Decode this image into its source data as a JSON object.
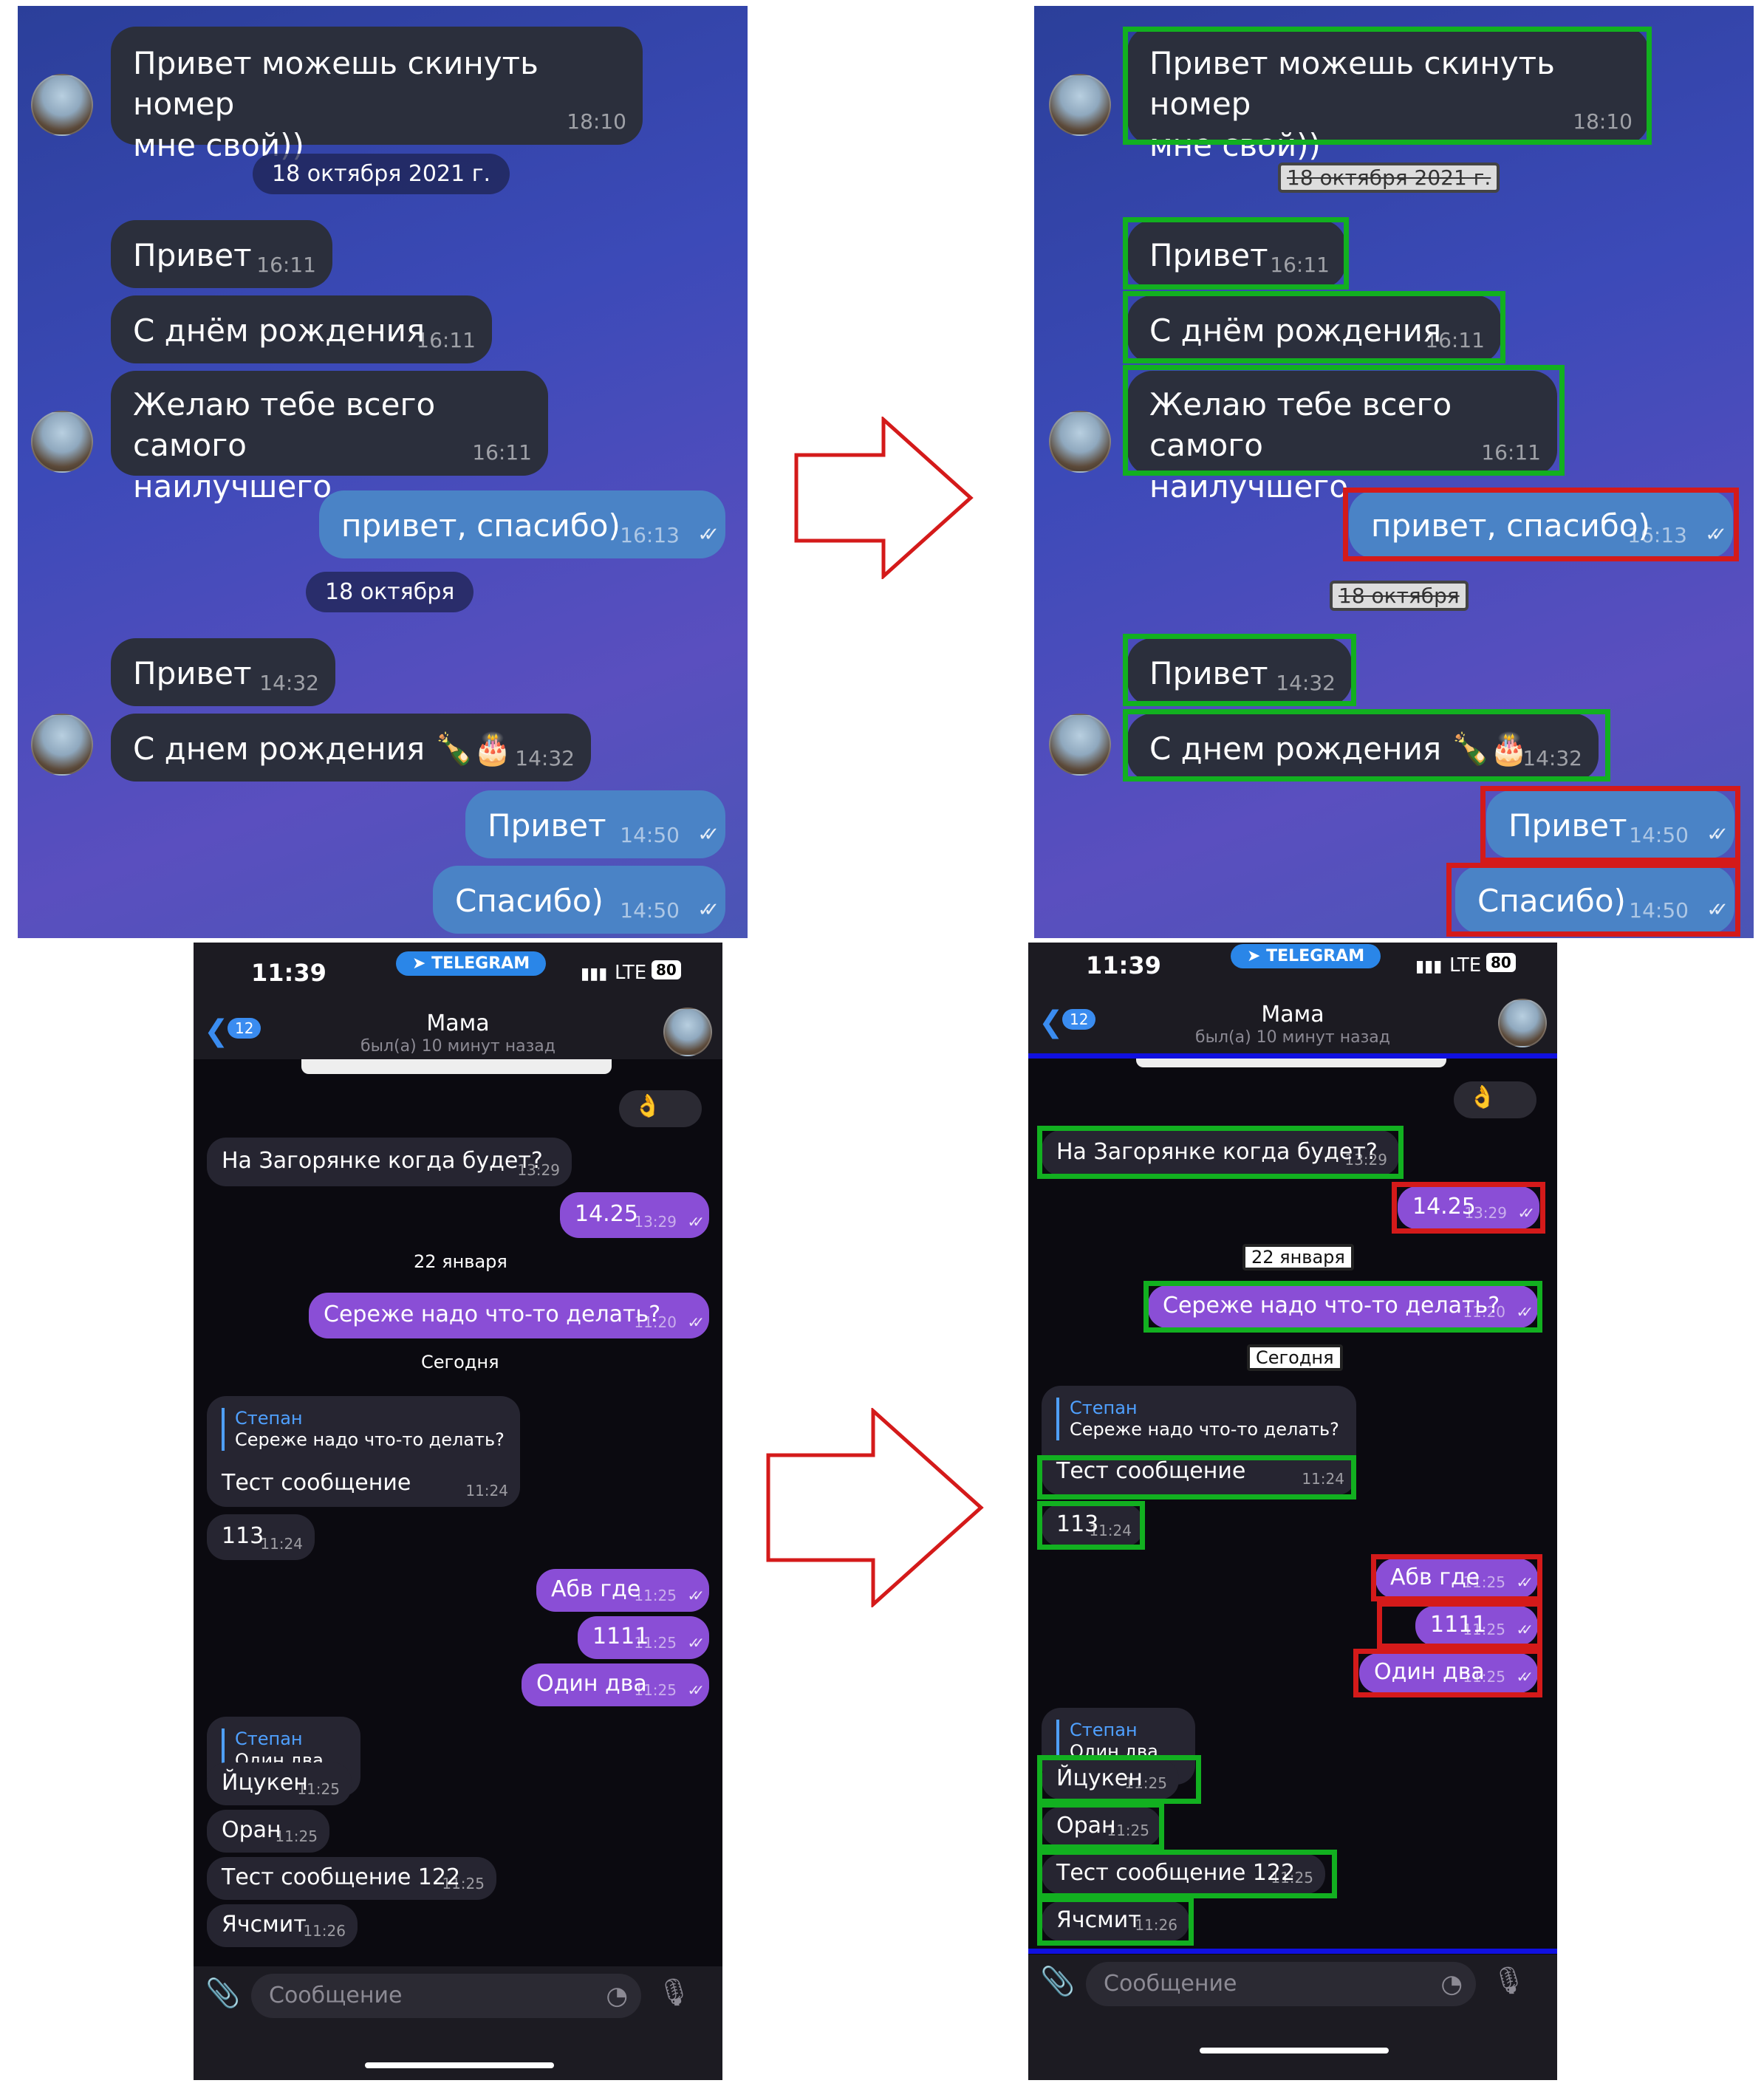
{
  "top_chat": {
    "messages": [
      {
        "text": "Привет можешь скинуть номер\nмне свой))",
        "time": "18:10"
      },
      {
        "text": "Привет",
        "time": "16:11"
      },
      {
        "text": "С днём рождения",
        "time": "16:11"
      },
      {
        "text": "Желаю тебе всего самого\nнаилучшего",
        "time": "16:11"
      },
      {
        "text": "привет, спасибо)",
        "time": "16:13"
      },
      {
        "text": "Привет",
        "time": "14:32"
      },
      {
        "text": "С днем рождения 🍾🎂",
        "time": "14:32"
      },
      {
        "text": "Привет",
        "time": "14:50"
      },
      {
        "text": "Спасибо)",
        "time": "14:50"
      }
    ],
    "date_1": "18 октября 2021 г.",
    "date_2": "18 октября"
  },
  "phone": {
    "status_time": "11:39",
    "app_pill": "TELEGRAM",
    "network": "LTE",
    "battery": "80",
    "back_count": "12",
    "contact_name": "Мама",
    "last_seen": "был(а) 10 минут назад",
    "input_placeholder": "Сообщение",
    "messages": {
      "m1": {
        "text": "На Загорянке когда будет?",
        "time": "13:29"
      },
      "m2": {
        "text": "14.25",
        "time": "13:29"
      },
      "date_jan": "22 января",
      "m3": {
        "text": "Сереже надо что-то делать?",
        "time": "11:20"
      },
      "date_today": "Сегодня",
      "reply1_name": "Степан",
      "reply1_text": "Сереже надо что-то делать?",
      "m4": {
        "text": "Тест сообщение",
        "time": "11:24"
      },
      "m5": {
        "text": "113",
        "time": "11:24"
      },
      "m6": {
        "text": "Абв где",
        "time": "11:25"
      },
      "m7": {
        "text": "1111",
        "time": "11:25"
      },
      "m8": {
        "text": "Один два",
        "time": "11:25"
      },
      "reply2_name": "Степан",
      "reply2_text": "Один два",
      "m9": {
        "text": "Йцукен",
        "time": "11:25"
      },
      "m10": {
        "text": "Оран",
        "time": "11:25"
      },
      "m11": {
        "text": "Тест сообщение 122",
        "time": "11:25"
      },
      "m12": {
        "text": "Ячсмит",
        "time": "11:26"
      }
    }
  },
  "colors": {
    "incoming_box": "#12b020",
    "outgoing_box": "#d41a1a",
    "region_line": "#1010e0",
    "arrow": "#d41a1a"
  }
}
